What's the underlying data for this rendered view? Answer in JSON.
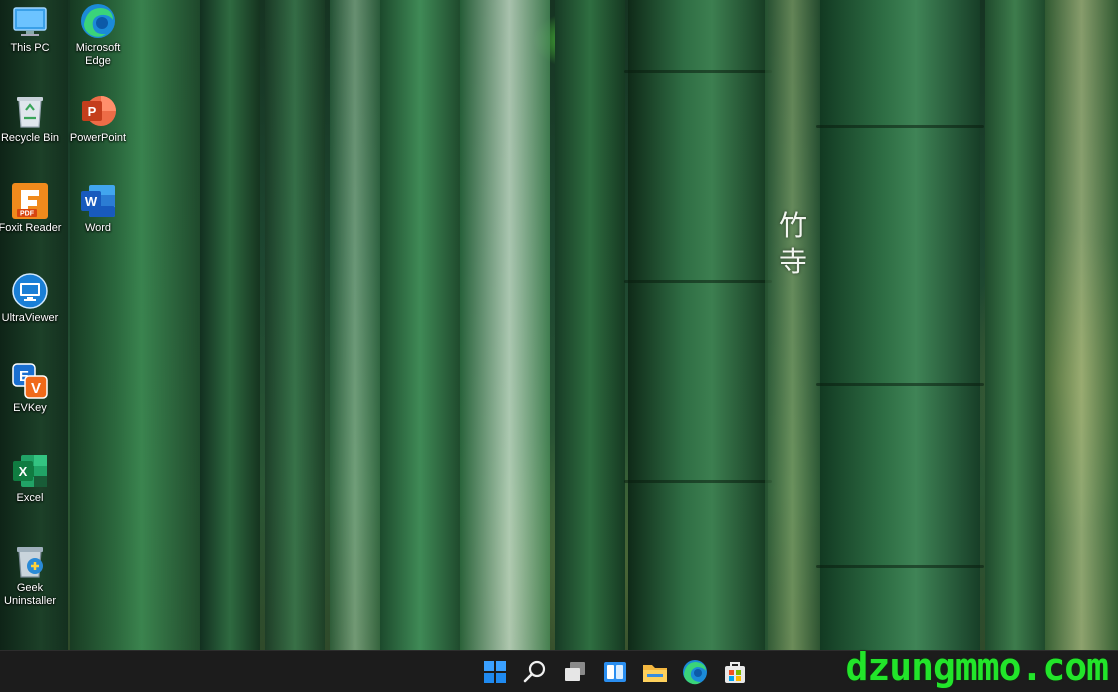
{
  "desktop": {
    "wallpaper_caption": "竹寺",
    "icons": [
      {
        "label": "This PC",
        "icon": "monitor-icon"
      },
      {
        "label": "Microsoft Edge",
        "icon": "edge-icon"
      },
      {
        "label": "Recycle Bin",
        "icon": "recycle-bin-icon"
      },
      {
        "label": "PowerPoint",
        "icon": "powerpoint-icon"
      },
      {
        "label": "Foxit Reader",
        "icon": "foxit-reader-icon"
      },
      {
        "label": "Word",
        "icon": "word-icon"
      },
      {
        "label": "UltraViewer",
        "icon": "ultraviewer-icon"
      },
      {
        "label": "EVKey",
        "icon": "evkey-icon"
      },
      {
        "label": "Excel",
        "icon": "excel-icon"
      },
      {
        "label": "Geek Uninstaller",
        "icon": "geek-uninstaller-icon"
      }
    ]
  },
  "taskbar": {
    "buttons": [
      {
        "name": "start",
        "icon": "windows-logo-icon"
      },
      {
        "name": "search",
        "icon": "search-icon"
      },
      {
        "name": "task-view",
        "icon": "task-view-icon"
      },
      {
        "name": "widgets",
        "icon": "widgets-icon"
      },
      {
        "name": "file-explorer",
        "icon": "folder-icon"
      },
      {
        "name": "edge",
        "icon": "edge-icon"
      },
      {
        "name": "microsoft-store",
        "icon": "store-icon"
      }
    ],
    "accent": "#0078d4"
  },
  "watermark": "dzungmmo.com",
  "colors": {
    "watermark": "#22e52a",
    "taskbar_bg": "#1c1c1c",
    "word": "#185abd",
    "excel": "#107c41",
    "powerpoint": "#c43e1c"
  }
}
